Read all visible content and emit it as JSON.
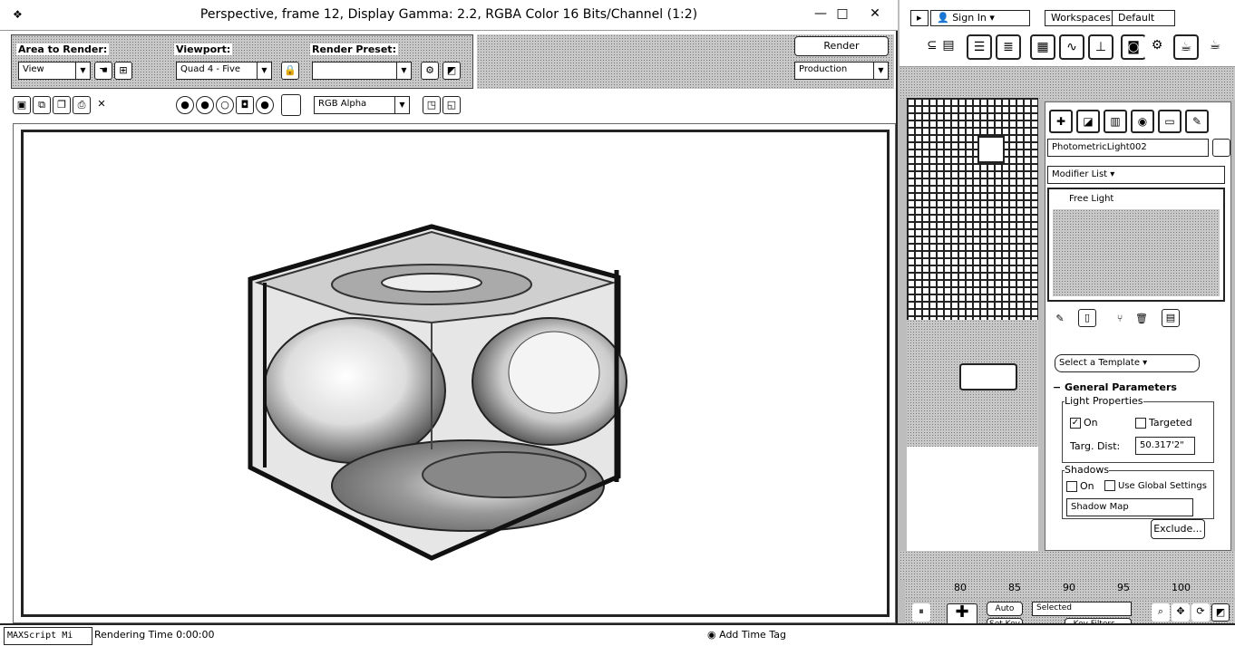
{
  "window": {
    "title": "Perspective, frame 12, Display Gamma: 2.2, RGBA Color 16 Bits/Channel (1:2)",
    "minimize_glyph": "—",
    "maximize_glyph": "□",
    "close_glyph": "✕"
  },
  "toolbar": {
    "area_label": "Area to Render:",
    "area_value": "View",
    "viewport_label": "Viewport:",
    "viewport_value": "Quad 4 - Five",
    "preset_label": "Render Preset:",
    "preset_value": "",
    "render_button": "Render",
    "production_value": "Production",
    "channel_value": "RGB Alpha"
  },
  "right_panel": {
    "sign_in": "Sign In",
    "workspaces": "Workspaces:",
    "workspace_value": "Default",
    "object_name": "PhotometricLight002",
    "modifier_list": "Modifier List",
    "stack_item": "Free Light",
    "template_dropdown": "Select a Template",
    "general_parameters": "General Parameters",
    "light_properties": "Light Properties",
    "on_label": "On",
    "targeted_label": "Targeted",
    "targ_dist_label": "Targ. Dist:",
    "targ_dist_value": "50.317'2\"",
    "shadows_label": "Shadows",
    "shadows_on": "On",
    "use_global": "Use Global Settings",
    "shadow_type": "Shadow Map",
    "exclude_button": "Exclude..."
  },
  "timeline": {
    "ticks": [
      "80",
      "85",
      "90",
      "95",
      "100"
    ],
    "auto_key": "Auto Key",
    "set_key": "Set Key",
    "selected": "Selected",
    "key_filters": "Key Filters..."
  },
  "bottom": {
    "script_label": "MAXScript Mi",
    "rendering_time_label": "Rendering Time",
    "rendering_time_value": "0:00:00",
    "add_time_tag": "Add Time Tag"
  },
  "colors": {
    "background": "#ffffff",
    "outline": "#222222",
    "dither": "#c8c8c8"
  }
}
